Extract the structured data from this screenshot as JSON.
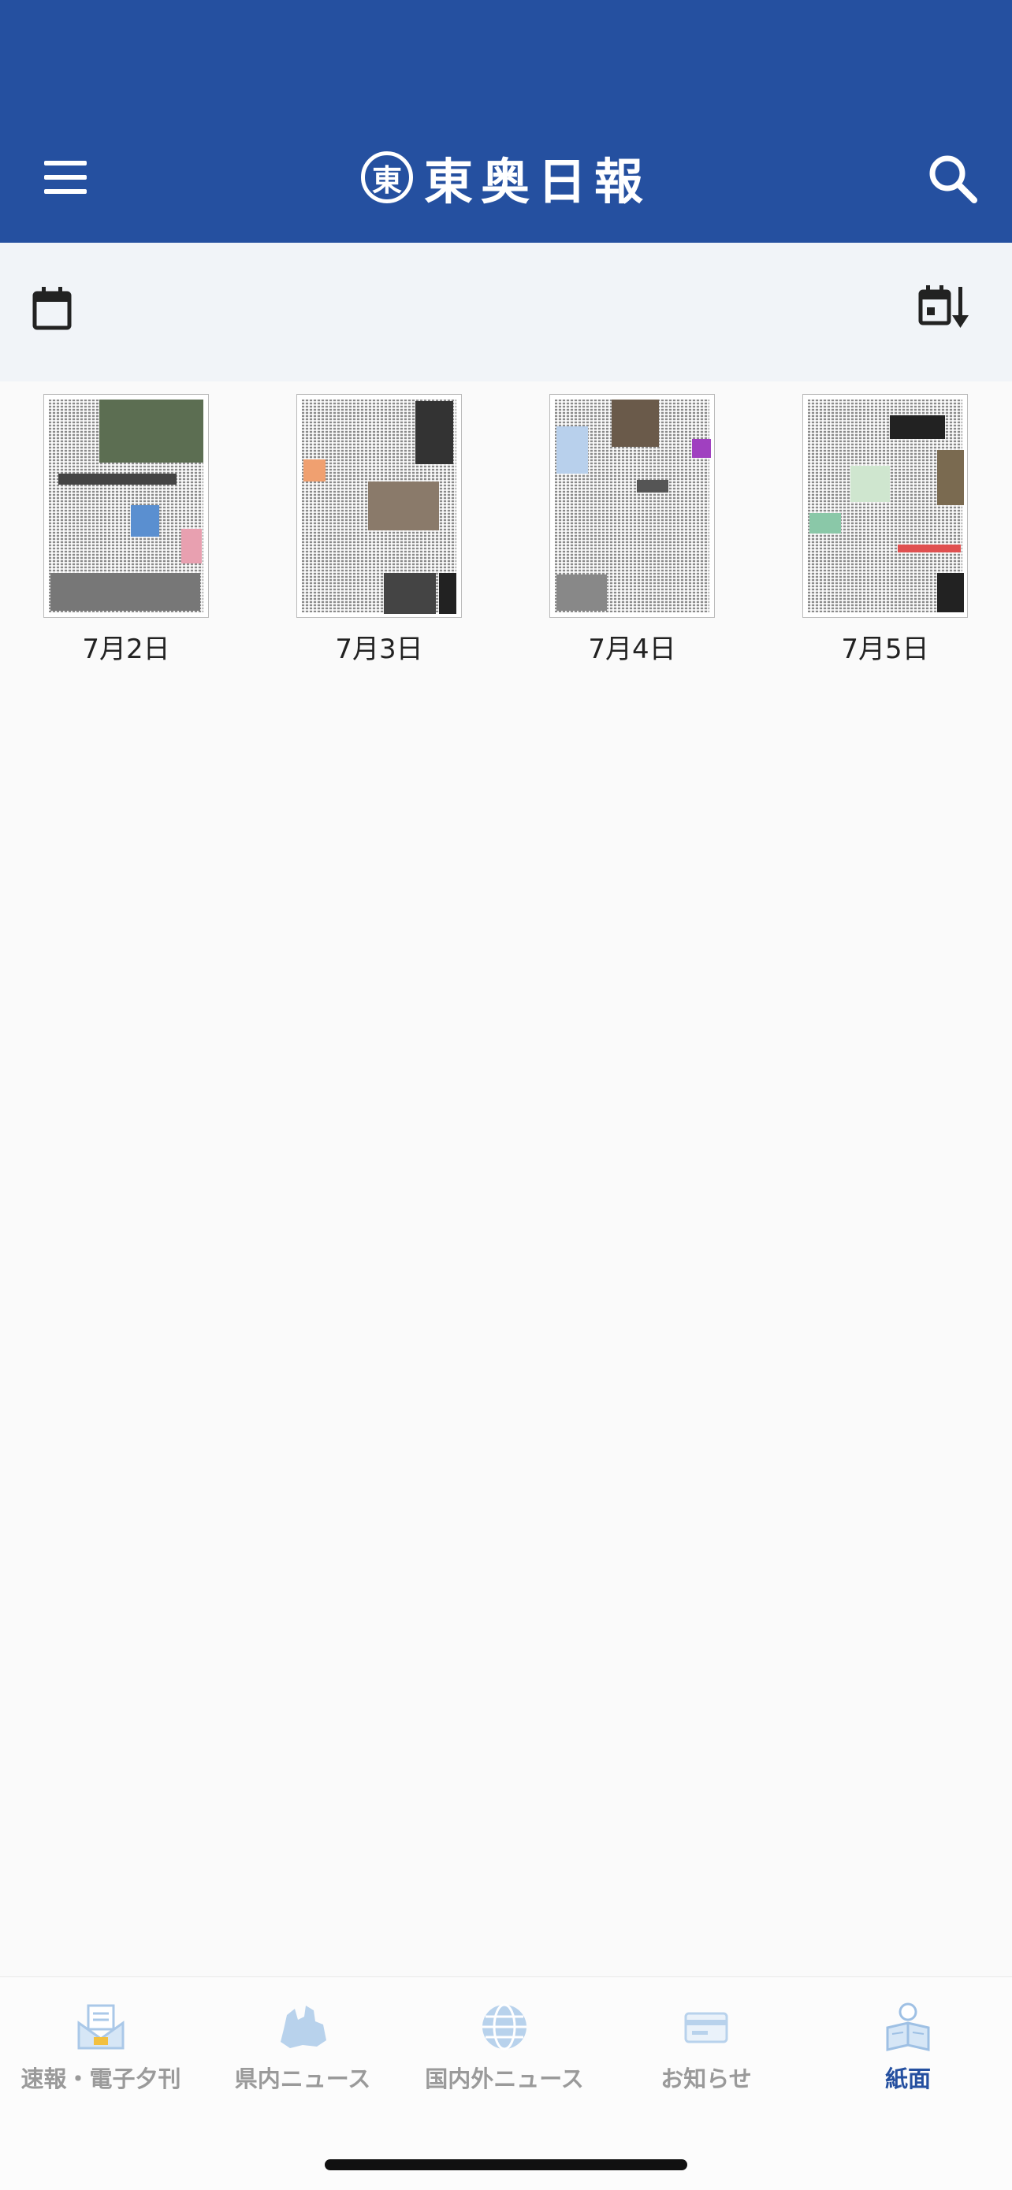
{
  "header": {
    "logo_mark": "東",
    "title": "東奥日報",
    "menu_icon": "hamburger-menu-icon",
    "search_icon": "search-icon",
    "background_color": "#2550a0"
  },
  "toolbar": {
    "calendar_icon": "calendar-icon",
    "sort_icon": "calendar-sort-descending-icon"
  },
  "papers": [
    {
      "date": "7月2日"
    },
    {
      "date": "7月3日"
    },
    {
      "date": "7月4日"
    },
    {
      "date": "7月5日"
    }
  ],
  "bottom_nav": {
    "tabs": [
      {
        "label": "速報・電子夕刊",
        "icon": "envelope-news-icon",
        "active": false
      },
      {
        "label": "県内ニュース",
        "icon": "prefecture-map-icon",
        "active": false
      },
      {
        "label": "国内外ニュース",
        "icon": "globe-icon",
        "active": false
      },
      {
        "label": "お知らせ",
        "icon": "card-icon",
        "active": false
      },
      {
        "label": "紙面",
        "icon": "newspaper-reader-icon",
        "active": true
      }
    ],
    "active_color": "#2550a0",
    "inactive_color": "#9a9a9a"
  }
}
